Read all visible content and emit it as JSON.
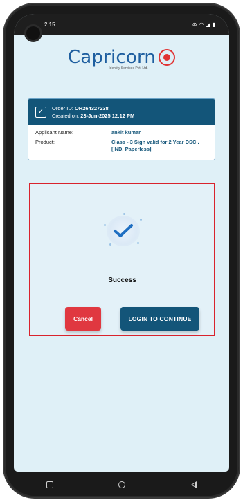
{
  "status_bar": {
    "time": "2:15",
    "icons": [
      "notification-icon",
      "wifi-icon",
      "signal-icon",
      "battery-icon"
    ]
  },
  "brand": {
    "name": "Capricorn",
    "subtitle": "Identity Services Pvt. Ltd."
  },
  "order": {
    "id_label": "Order ID:",
    "id_value": "OR264327238",
    "created_label": "Created on:",
    "created_value": "23-Jun-2025 12:12 PM",
    "applicant_label": "Applicant Name:",
    "applicant_value": "ankit kumar",
    "product_label": "Product:",
    "product_value": "Class - 3 Sign valid for 2 Year DSC . [IND, Paperless]"
  },
  "result": {
    "label": "Success",
    "cancel_button": "Cancel",
    "login_button": "LOGIN TO CONTINUE"
  },
  "colors": {
    "primary": "#135579",
    "danger": "#e03840",
    "highlight_border": "#d9232d",
    "screen_bg": "#dff0f7"
  }
}
